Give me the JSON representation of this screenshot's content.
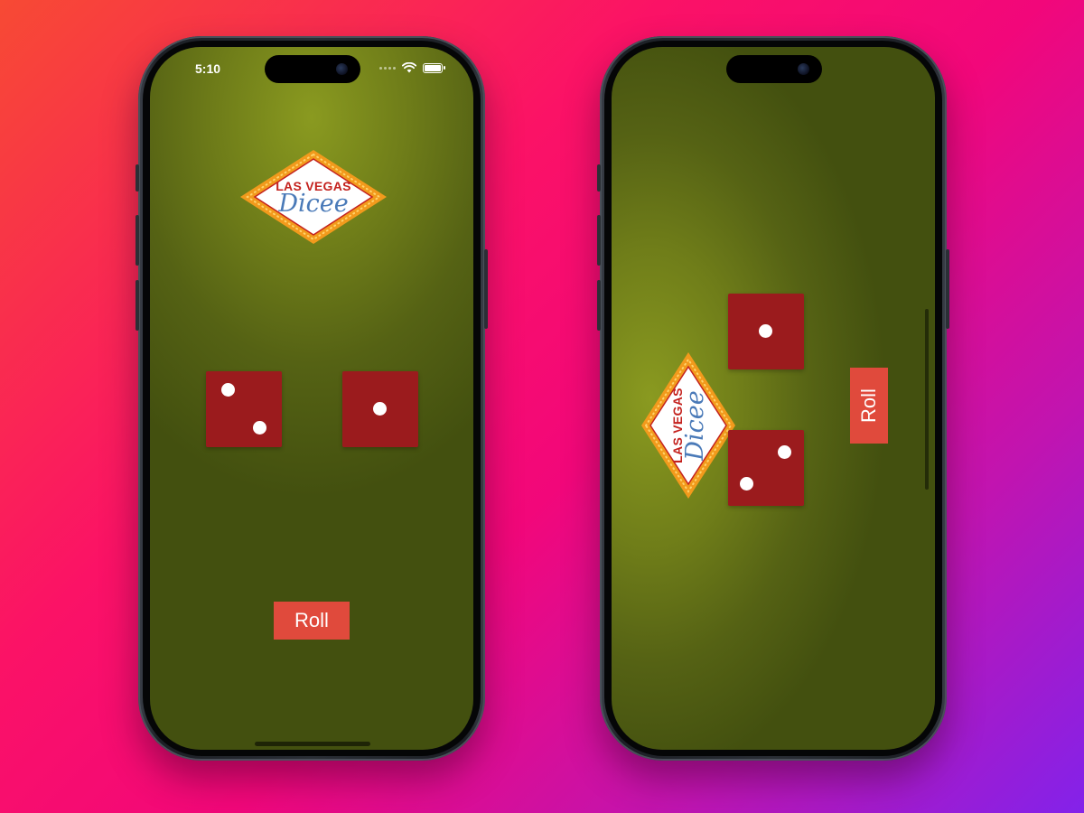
{
  "app": {
    "name_line1": "LAS VEGAS",
    "name_line2": "Dicee"
  },
  "phones": [
    {
      "orientation": "portrait",
      "status_bar": {
        "time": "5:10"
      },
      "dice": [
        {
          "value": 2
        },
        {
          "value": 1
        }
      ],
      "roll_button_label": "Roll"
    },
    {
      "orientation": "landscape",
      "dice": [
        {
          "value": 1
        },
        {
          "value": 2
        }
      ],
      "roll_button_label": "Roll"
    }
  ],
  "colors": {
    "felt": "#6f7d19",
    "die": "#9b1b1d",
    "pip": "#ffffff",
    "button": "#e04a3c",
    "logo_red": "#c4221e",
    "logo_blue": "#4a7ab8",
    "logo_border": "#f29a1c"
  },
  "icons": [
    "signal-dots-icon",
    "wifi-icon",
    "battery-icon",
    "front-camera-icon"
  ]
}
